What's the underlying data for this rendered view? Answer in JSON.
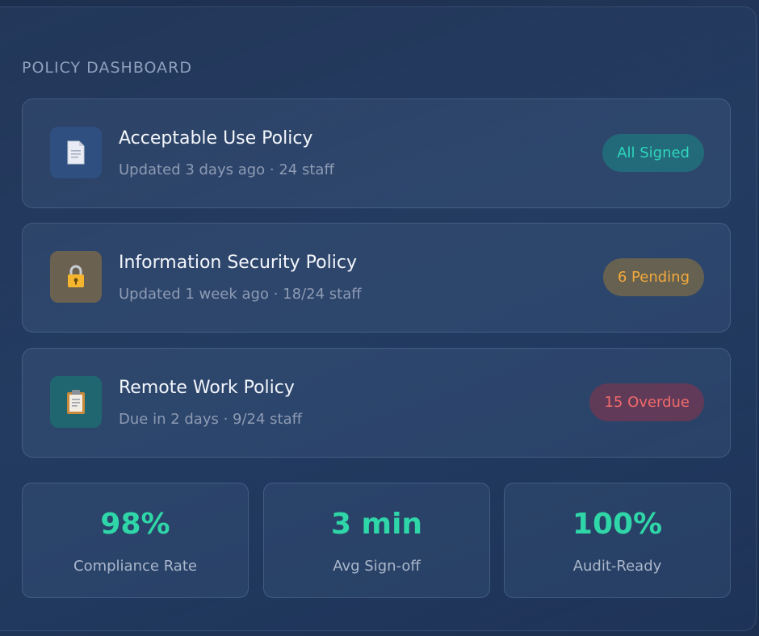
{
  "dashboard": {
    "title": "POLICY DASHBOARD",
    "policies": [
      {
        "name": "Acceptable Use Policy",
        "meta": "Updated 3 days ago · 24 staff",
        "status": "All Signed",
        "icon": "document-icon",
        "icon_bg": "#2e4f80"
      },
      {
        "name": "Information Security Policy",
        "meta": "Updated 1 week ago · 18/24 staff",
        "status": "6 Pending",
        "icon": "lock-icon",
        "icon_bg": "#6b6150"
      },
      {
        "name": "Remote Work Policy",
        "meta": "Due in 2 days · 9/24 staff",
        "status": "15 Overdue",
        "icon": "clipboard-icon",
        "icon_bg": "#1f6670"
      }
    ],
    "stats": [
      {
        "value": "98%",
        "label": "Compliance Rate"
      },
      {
        "value": "3 min",
        "label": "Avg Sign-off"
      },
      {
        "value": "100%",
        "label": "Audit-Ready"
      }
    ],
    "colors": {
      "accent": "#2fd6a8",
      "signed": "#2fd6bd",
      "pending": "#f3a93a",
      "overdue": "#f26a6a"
    }
  }
}
